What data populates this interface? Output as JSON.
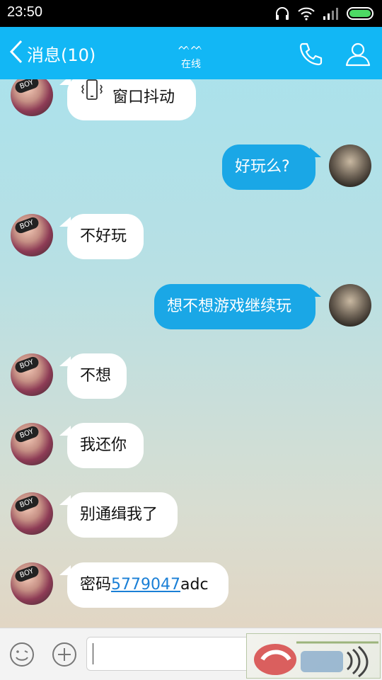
{
  "status_bar": {
    "time": "23:50",
    "icons": [
      "headphones-icon",
      "wifi-icon",
      "signal-icon",
      "battery-icon"
    ]
  },
  "header": {
    "back_label": "消息(10)",
    "contact_name": "ᨓᨓ",
    "contact_status": "在线",
    "icons": [
      "phone-icon",
      "profile-icon"
    ],
    "accent_color": "#12b7f5"
  },
  "messages": [
    {
      "side": "in",
      "type": "shake",
      "text": "窗口抖动"
    },
    {
      "side": "out",
      "text": "好玩么?"
    },
    {
      "side": "in",
      "text": "不好玩"
    },
    {
      "side": "out",
      "text": "想不想游戏继续玩"
    },
    {
      "side": "in",
      "text": "不想"
    },
    {
      "side": "in",
      "text": "我还你"
    },
    {
      "side": "in",
      "text": "别通缉我了"
    },
    {
      "side": "in",
      "text_prefix": "密码",
      "link": "5779047",
      "text_suffix": "adc"
    }
  ],
  "friend_avatar_badge": "BOY",
  "input_bar": {
    "placeholder": "",
    "icons": [
      "emoji-icon",
      "plus-icon"
    ]
  },
  "colors": {
    "outgoing_bubble": "#1aa7e6",
    "incoming_bubble": "#ffffff",
    "link": "#1a7fd6"
  }
}
